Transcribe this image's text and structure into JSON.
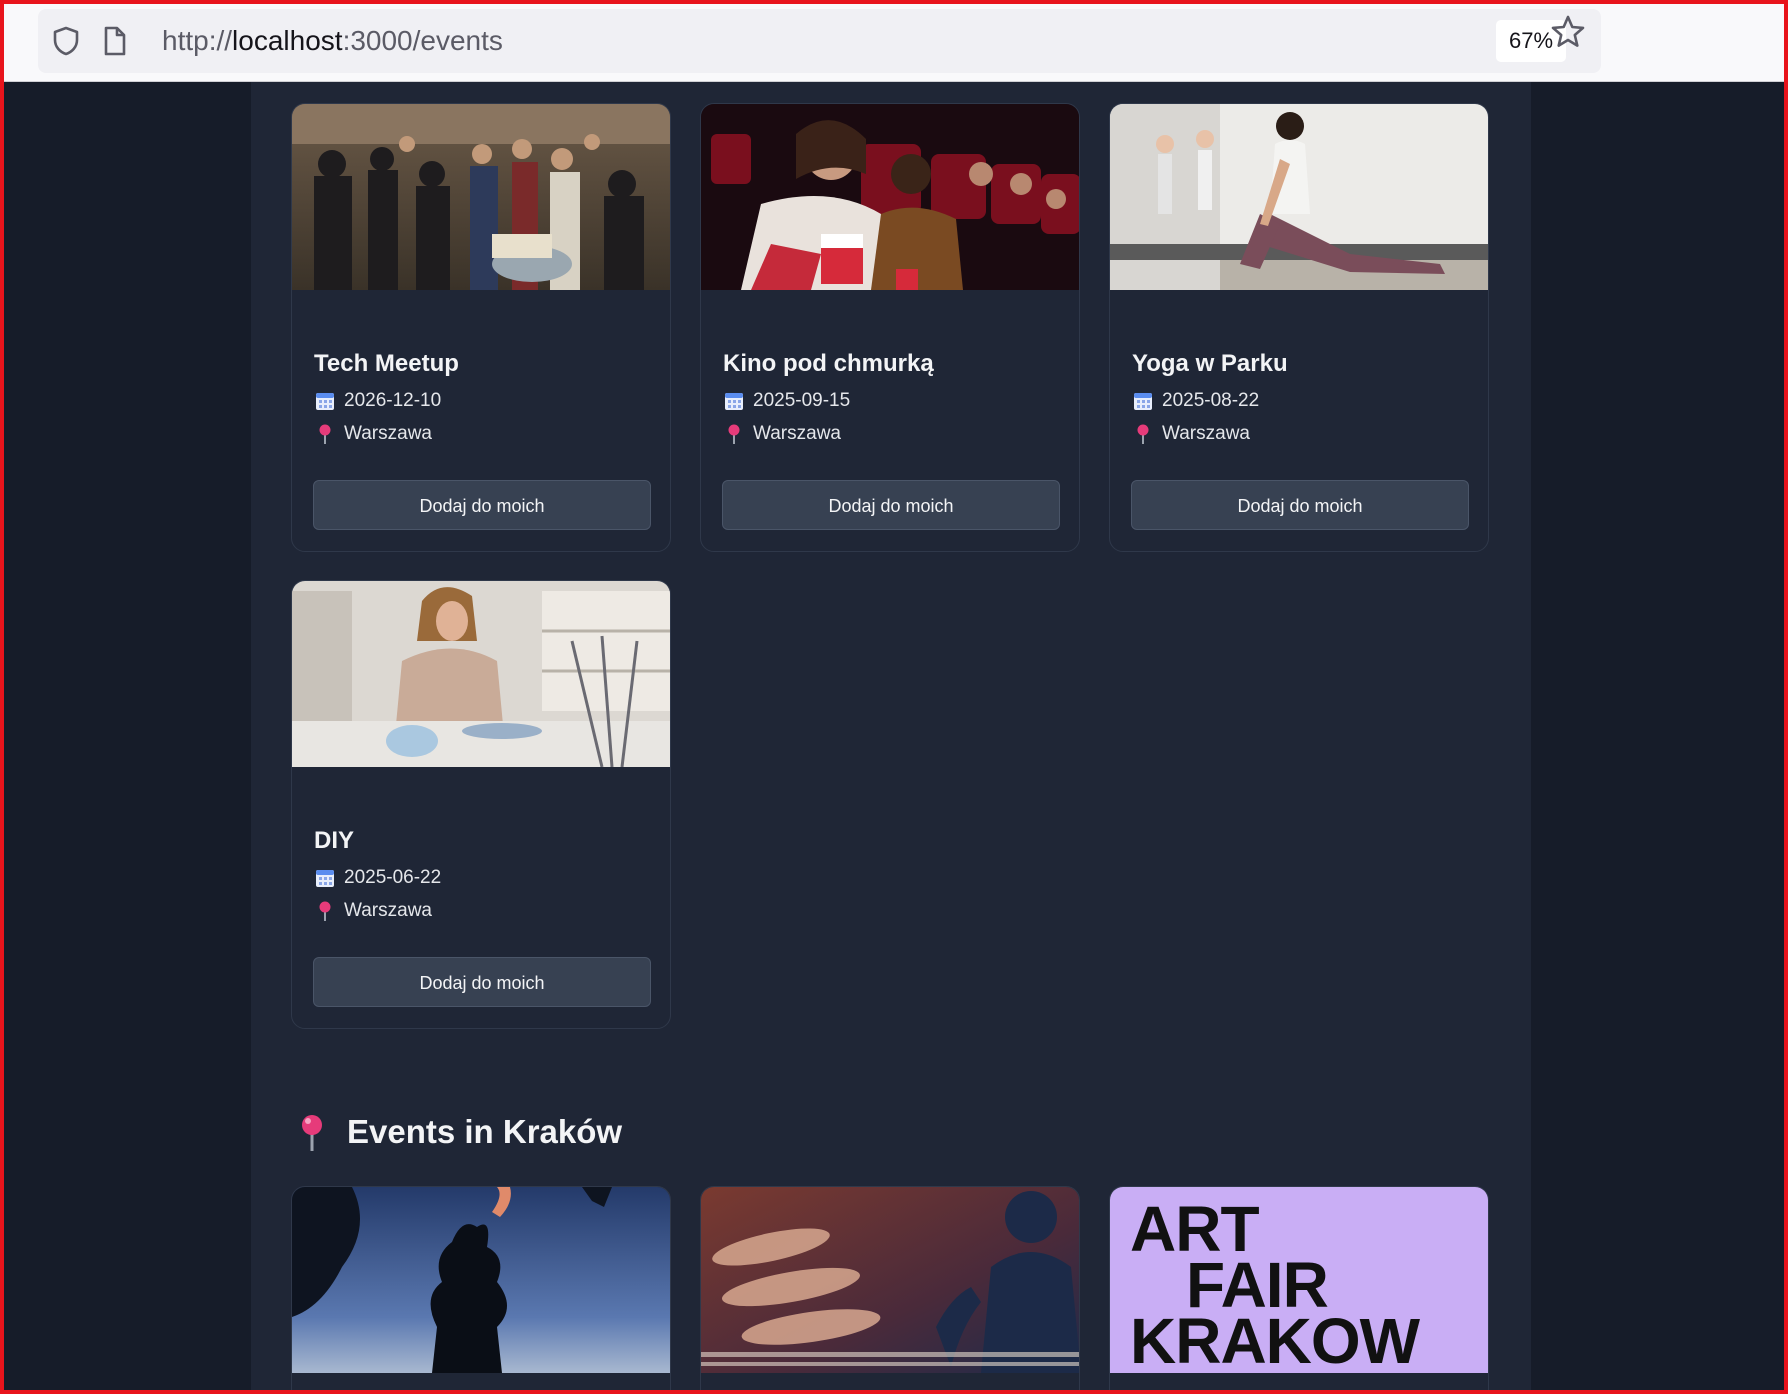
{
  "browser": {
    "url_scheme": "http://",
    "url_host": "localhost",
    "url_path": ":3000/events",
    "zoom": "67%",
    "icons": [
      "shield-icon",
      "page-icon",
      "star-icon"
    ]
  },
  "events_top": [
    {
      "title": "Tech Meetup",
      "date": "2026-12-10",
      "location": "Warszawa",
      "button": "Dodaj do moich",
      "image": "crowd-networking-photo"
    },
    {
      "title": "Kino pod chmurką",
      "date": "2025-09-15",
      "location": "Warszawa",
      "button": "Dodaj do moich",
      "image": "cinema-audience-photo"
    },
    {
      "title": "Yoga w Parku",
      "date": "2025-08-22",
      "location": "Warszawa",
      "button": "Dodaj do moich",
      "image": "yoga-pose-photo"
    },
    {
      "title": "DIY",
      "date": "2025-06-22",
      "location": "Warszawa",
      "button": "Dodaj do moich",
      "image": "crafting-workshop-photo"
    }
  ],
  "section_krakow": {
    "heading": "Events in Kraków",
    "icon": "pin-icon"
  },
  "events_krakow_images": [
    {
      "image": "dragon-statue-photo"
    },
    {
      "image": "jazz-piano-saxophone-photo"
    },
    {
      "image": "art-fair-poster",
      "poster_lines": [
        "ART",
        "FAIR",
        "KRAKOW"
      ],
      "poster_color": "#c9aef5"
    }
  ],
  "colors": {
    "page_bg": "#161c29",
    "panel_bg": "#1f2636",
    "button_bg": "#374152",
    "text": "#f3f4f6",
    "pin": "#e63b7a",
    "calendar": "#5b8def"
  }
}
